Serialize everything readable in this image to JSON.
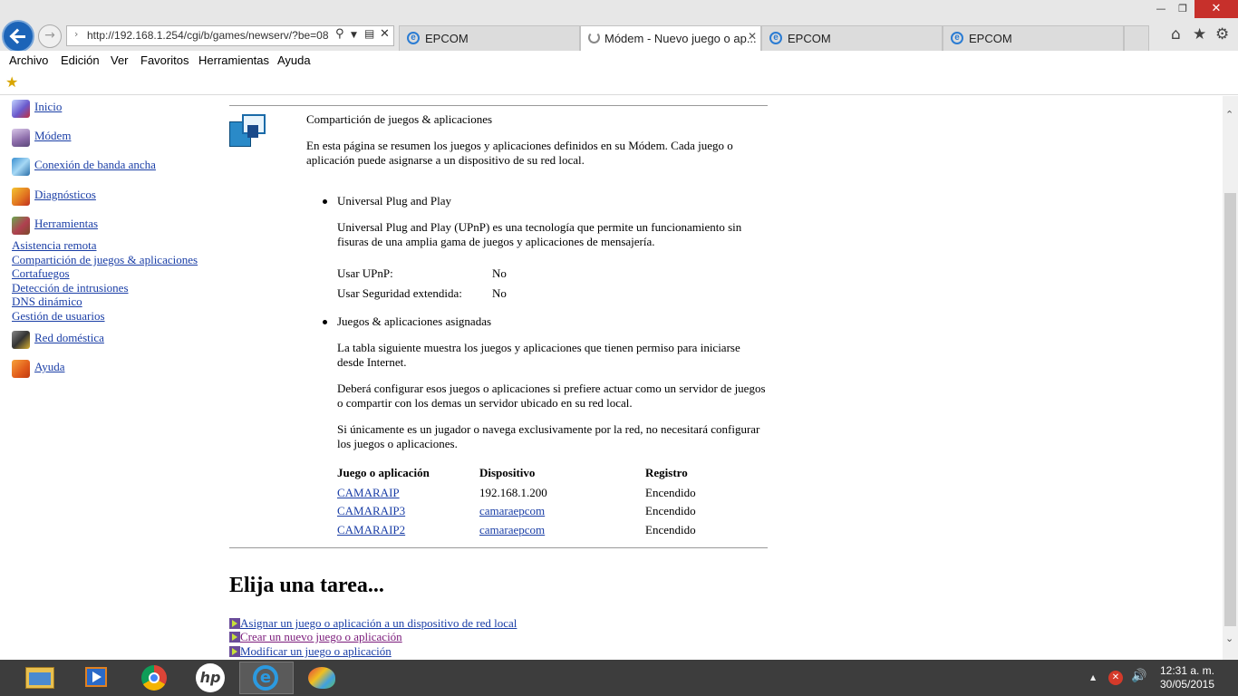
{
  "browser": {
    "url": "http://192.168.1.254/cgi/b/games/newserv/?be=08",
    "tabs": [
      {
        "label": "EPCOM",
        "active": false,
        "loading": false
      },
      {
        "label": "Módem - Nuevo juego o ap...",
        "active": true,
        "loading": true
      },
      {
        "label": "EPCOM",
        "active": false,
        "loading": false
      },
      {
        "label": "EPCOM",
        "active": false,
        "loading": false
      }
    ],
    "menu": [
      "Archivo",
      "Edición",
      "Ver",
      "Favoritos",
      "Herramientas",
      "Ayuda"
    ],
    "icons": {
      "back": "back-arrow-icon",
      "forward": "forward-arrow-icon",
      "home": "home-icon",
      "favorites": "star-icon",
      "settings": "gear-icon"
    }
  },
  "sidebar": {
    "main_items": [
      {
        "label": "Inicio",
        "icon": "home-page-icon"
      },
      {
        "label": "Módem",
        "icon": "modem-icon"
      },
      {
        "label": "Conexión de banda ancha",
        "icon": "broadband-icon"
      },
      {
        "label": "Diagnósticos",
        "icon": "diagnostics-icon"
      },
      {
        "label": "Herramientas",
        "icon": "tools-icon"
      }
    ],
    "sub_items": [
      "Asistencia remota",
      "Compartición de juegos & aplicaciones",
      "Cortafuegos",
      "Detección de intrusiones",
      "DNS dinámico",
      "Gestión de usuarios"
    ],
    "bottom_items": [
      {
        "label": "Red doméstica",
        "icon": "home-network-icon"
      },
      {
        "label": "Ayuda",
        "icon": "help-icon"
      }
    ]
  },
  "main": {
    "section_title": "Compartición de juegos & aplicaciones",
    "intro": "En esta página se resumen los juegos y aplicaciones definidos en su Módem. Cada juego o aplicación puede asignarse a un dispositivo de su red local.",
    "upnp": {
      "heading": "Universal Plug and Play",
      "description": "Universal Plug and Play (UPnP) es una tecnología que permite un funcionamiento sin fisuras de una amplia gama de juegos y aplicaciones de mensajería.",
      "fields": [
        {
          "label": "Usar UPnP:",
          "value": "No"
        },
        {
          "label": "Usar Seguridad extendida:",
          "value": "No"
        }
      ]
    },
    "assigned": {
      "heading": "Juegos & aplicaciones asignadas",
      "para1": "La tabla siguiente muestra los juegos y aplicaciones que tienen permiso para iniciarse desde Internet.",
      "para2": "Deberá configurar esos juegos o aplicaciones si prefiere actuar como un servidor de juegos o compartir con los demas un servidor ubicado en su red local.",
      "para3": "Si únicamente es un jugador o navega exclusivamente por la red, no necesitará configurar los juegos o aplicaciones.",
      "columns": [
        "Juego o aplicación",
        "Dispositivo",
        "Registro"
      ],
      "rows": [
        {
          "app": "CAMARAIP",
          "device": "192.168.1.200",
          "device_link": false,
          "status": "Encendido"
        },
        {
          "app": "CAMARAIP3",
          "device": "camaraepcom",
          "device_link": true,
          "status": "Encendido"
        },
        {
          "app": "CAMARAIP2",
          "device": "camaraepcom",
          "device_link": true,
          "status": "Encendido"
        }
      ]
    }
  },
  "tasks": {
    "title": "Elija una tarea...",
    "items": [
      "Asignar un juego o aplicación a un dispositivo de red local",
      "Crear un nuevo juego o aplicación",
      "Modificar un juego o aplicación"
    ]
  },
  "taskbar": {
    "apps": [
      "file-explorer-icon",
      "video-player-icon",
      "chrome-icon",
      "hp-icon",
      "internet-explorer-icon",
      "paint-icon"
    ],
    "time": "12:31 a. m.",
    "date": "30/05/2015"
  }
}
